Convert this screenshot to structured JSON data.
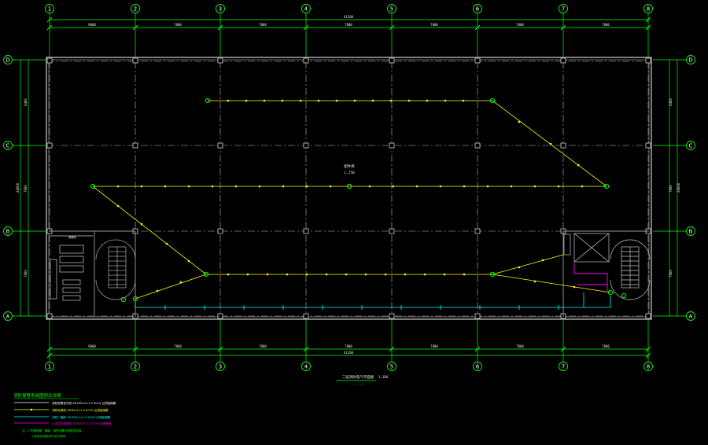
{
  "grid_columns": [
    "1",
    "2",
    "3",
    "4",
    "5",
    "6",
    "7",
    "8"
  ],
  "grid_rows": [
    "D",
    "C",
    "B",
    "A"
  ],
  "dims": {
    "top_total": "61200",
    "top_spans": [
      "9000",
      "7800",
      "7800",
      "7800",
      "7800",
      "7800",
      "7800"
    ],
    "bottom_total": "61200",
    "bottom_spans": [
      "9000",
      "7800",
      "7800",
      "7800",
      "7800",
      "7800",
      "7800"
    ],
    "side_total": "24000",
    "side_spans": [
      "8400",
      "7800",
      "7800"
    ]
  },
  "room_label": {
    "name": "配件库",
    "area": "1,750"
  },
  "stair_label": "楼梯间",
  "plan_title": "二层消防电气平面图",
  "plan_scale": "1:100",
  "plan_subtitle": "——————",
  "legend": {
    "title": "消防报警系统图例及说明",
    "items": [
      {
        "text": "消防报警信号线 ZR-RVS-2×1.5 SC15 沿顶板暗敷",
        "color": "#ffffff"
      },
      {
        "text": "消防电源线 ZR-BV-2×2.5 SC20 沿顶板暗敷",
        "color": "#ffff00"
      },
      {
        "text": "消防广播线 ZR-RVS-2×1.5 SC15 沿顶板暗敷",
        "color": "#00ffff"
      },
      {
        "text": "火灾应急照明线 ZR-BV-3×2.5 SC20 沿墙暗敷",
        "color": "#ff00ff"
      }
    ],
    "notes": [
      "注：1.所有线路、管道、消防设备均按规范安装",
      "2.其他见消防电气设计说明"
    ]
  },
  "colors": {
    "grid": "#00ff00",
    "wall": "#9a9a9a",
    "axis": "#c8c8c8",
    "fire_line": "#ffff00",
    "signal": "#00ffff",
    "alarm": "#ff00ff"
  }
}
